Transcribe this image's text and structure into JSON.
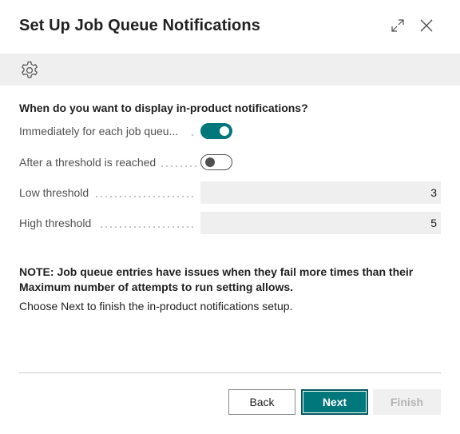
{
  "dialog": {
    "title": "Set Up Job Queue Notifications"
  },
  "toolbar": {
    "icon": "gear-icon"
  },
  "form": {
    "question": "When do you want to display in-product notifications?",
    "fields": [
      {
        "label": "Immediately for each job queu...",
        "type": "toggle",
        "value": true
      },
      {
        "label": "After a threshold is reached",
        "type": "toggle",
        "value": false
      },
      {
        "label": "Low threshold",
        "type": "number",
        "value": "3"
      },
      {
        "label": "High threshold",
        "type": "number",
        "value": "5"
      }
    ]
  },
  "note": {
    "text": "NOTE: Job queue entries have issues when they fail more times than their Maximum number of attempts to run setting allows.",
    "instruction": "Choose Next to finish the in-product notifications setup."
  },
  "buttons": {
    "back": "Back",
    "next": "Next",
    "finish": "Finish"
  },
  "colors": {
    "accent": "#00777a",
    "toolbar_bg": "#efefef",
    "field_bg": "#efefef",
    "disabled_text": "#b3b3b3"
  }
}
